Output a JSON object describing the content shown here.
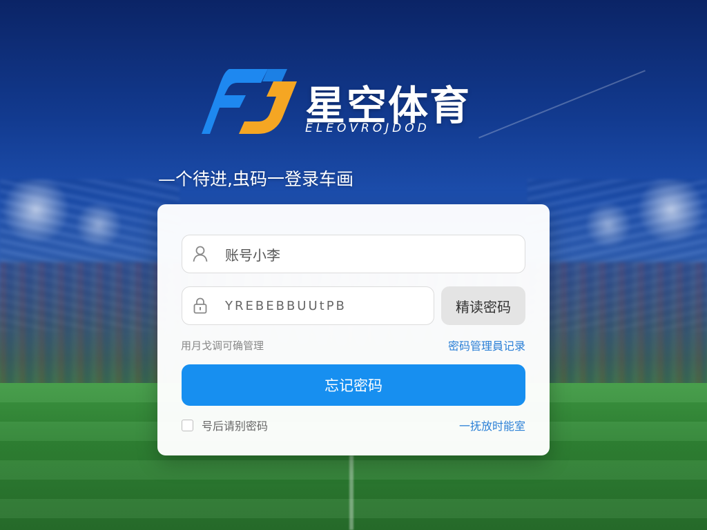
{
  "brand": {
    "title": "星空体育",
    "subtitle": "ELEOVROJDOD",
    "mark_colors": {
      "blue": "#1e88f0",
      "orange": "#f5a623"
    }
  },
  "tagline": "—个待进,虫码一登录车画",
  "form": {
    "account": {
      "value": "账号小李",
      "icon": "user-icon"
    },
    "password": {
      "value": "YREBEBBUUtPB",
      "icon": "lock-icon"
    },
    "password_button": "精读密码",
    "hint": "用月戈调可确管理",
    "password_manage_link": "密码管理員记录",
    "submit_label": "忘记密码",
    "remember_label": "号后请别密码",
    "remember_checked": false,
    "bottom_right_link": "一抚放时能室"
  },
  "colors": {
    "primary": "#178ff0",
    "link": "#2a7fd6",
    "card_bg": "#ffffff"
  }
}
